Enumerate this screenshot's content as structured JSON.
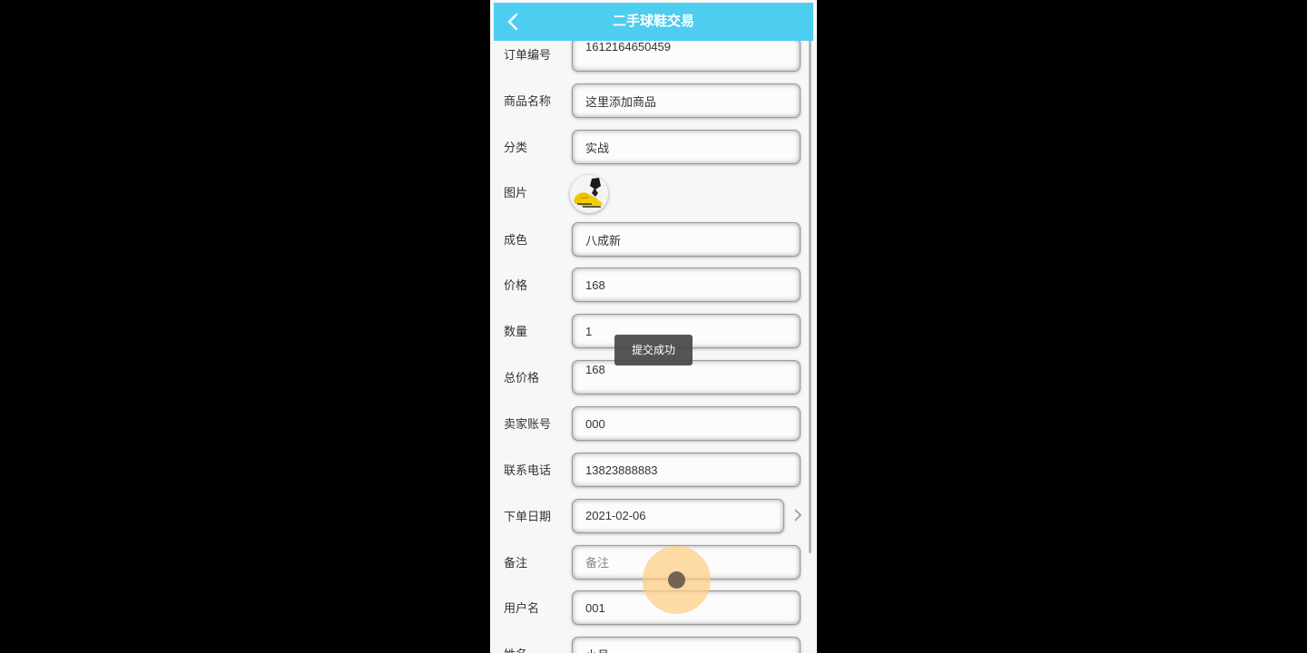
{
  "header": {
    "title": "二手球鞋交易",
    "back_icon": "chevron-left-icon"
  },
  "form": {
    "order_no": {
      "label": "订单编号",
      "value": "1612164650459"
    },
    "product_name": {
      "label": "商品名称",
      "value": "这里添加商品"
    },
    "category": {
      "label": "分类",
      "value": "实战"
    },
    "image": {
      "label": "图片",
      "icon": "sneaker-thumbnail"
    },
    "condition": {
      "label": "成色",
      "value": "八成新"
    },
    "price": {
      "label": "价格",
      "value": "168"
    },
    "quantity": {
      "label": "数量",
      "value": "1"
    },
    "total": {
      "label": "总价格",
      "value": "168"
    },
    "seller_account": {
      "label": "卖家账号",
      "value": "000"
    },
    "phone": {
      "label": "联系电话",
      "value": "13823888883"
    },
    "order_date": {
      "label": "下单日期",
      "value": "2021-02-06",
      "icon": "chevron-right-icon"
    },
    "remark": {
      "label": "备注",
      "value": "",
      "placeholder": "备注"
    },
    "username": {
      "label": "用户名",
      "value": "001"
    },
    "name": {
      "label": "姓名",
      "value": "小月"
    }
  },
  "toast": {
    "text": "提交成功"
  },
  "colors": {
    "header_bg": "#4dcdf0",
    "page_bg": "#f7f7f7",
    "toast_bg": "#464646"
  }
}
